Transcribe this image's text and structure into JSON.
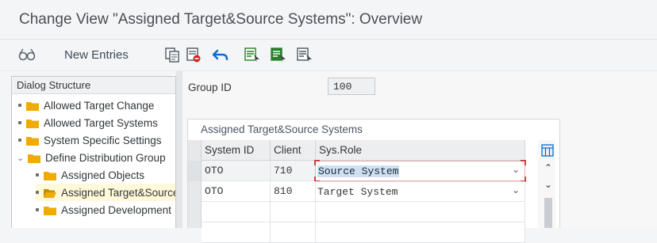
{
  "window": {
    "title": "Change View \"Assigned Target&Source Systems\": Overview"
  },
  "toolbar": {
    "new_entries_label": "New Entries",
    "icons": [
      "glasses-icon",
      "copy-icon",
      "delete-icon",
      "undo-icon",
      "select-all-icon",
      "select-block-icon",
      "deselect-all-icon"
    ]
  },
  "dialog_structure": {
    "header": "Dialog Structure",
    "items": [
      {
        "label": "Allowed Target Change",
        "level": 1,
        "selected": false
      },
      {
        "label": "Allowed Target Systems",
        "level": 1,
        "selected": false
      },
      {
        "label": "System Specific Settings",
        "level": 1,
        "selected": false
      },
      {
        "label": "Define Distribution Group",
        "level": 1,
        "expanded": true,
        "selected": false
      },
      {
        "label": "Assigned Objects",
        "level": 2,
        "selected": false
      },
      {
        "label": "Assigned Target&Source Systems",
        "level": 2,
        "selected": true
      },
      {
        "label": "Assigned Development",
        "level": 2,
        "selected": false
      }
    ]
  },
  "group": {
    "label": "Group ID",
    "value": "100"
  },
  "table": {
    "title": "Assigned Target&Source Systems",
    "columns": [
      "System ID",
      "Client",
      "Sys.Role"
    ],
    "rows": [
      {
        "system_id": "OTO",
        "client": "710",
        "role": "Source System",
        "focused": true
      },
      {
        "system_id": "OTO",
        "client": "810",
        "role": "Target System",
        "focused": false
      }
    ]
  },
  "colors": {
    "folder": "#f0ab00",
    "highlight": "#cfe0f2",
    "selected_tree": "#fff9d9"
  }
}
